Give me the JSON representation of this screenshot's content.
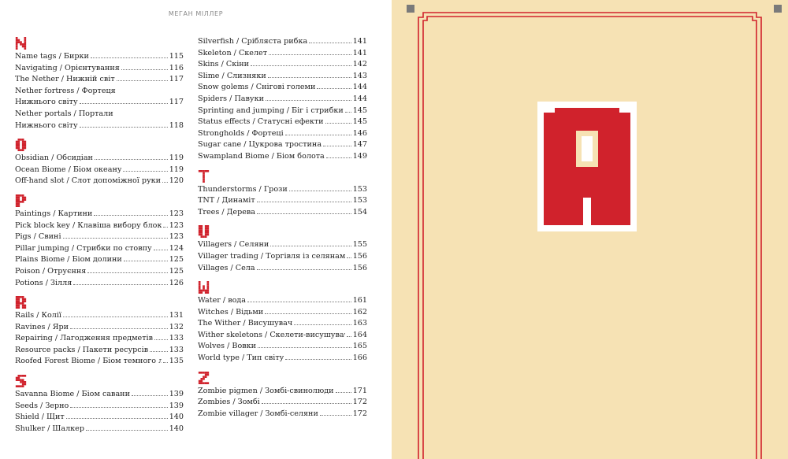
{
  "running_head": "МЕГАН МІЛЛЕР",
  "colors": {
    "accent_red": "#d0222c",
    "page_left": "#ffffff",
    "page_right": "#f6e2b4"
  },
  "left_column": [
    {
      "letter": "N",
      "entries": [
        {
          "text": "Name tags / Бирки",
          "page": "115"
        },
        {
          "text": "Navigating / Орієнтування",
          "page": "116"
        },
        {
          "text": "The Nether / Нижній світ",
          "page": "117"
        },
        {
          "text": "Nether fortress / Фортеця",
          "text2": "Нижнього світу",
          "page": "117"
        },
        {
          "text": "Nether portals / Портали",
          "text2": "Нижнього світу",
          "page": "118"
        }
      ]
    },
    {
      "letter": "O",
      "entries": [
        {
          "text": "Obsidian / Обсидіан",
          "page": "119"
        },
        {
          "text": "Ocean Biome / Біом океану",
          "page": "119"
        },
        {
          "text": "Off-hand slot / Слот допоміжної руки",
          "page": "120"
        }
      ]
    },
    {
      "letter": "P",
      "entries": [
        {
          "text": "Paintings / Картини",
          "page": "123"
        },
        {
          "text": "Pick block key / Клавіша вибору блока",
          "page": "123"
        },
        {
          "text": "Pigs / Свині",
          "page": "123"
        },
        {
          "text": "Pillar jumping / Стрибки по стовпу",
          "page": "124"
        },
        {
          "text": "Plains Biome / Біом долини",
          "page": "125"
        },
        {
          "text": "Poison / Отруєння",
          "page": "125"
        },
        {
          "text": "Potions / Зілля",
          "page": "126"
        }
      ]
    },
    {
      "letter": "R",
      "entries": [
        {
          "text": "Rails / Колії",
          "page": "131"
        },
        {
          "text": "Ravines / Яри",
          "page": "132"
        },
        {
          "text": "Repairing / Лагодження предметів",
          "page": "133"
        },
        {
          "text": "Resource packs / Пакети ресурсів",
          "page": "133"
        },
        {
          "text": "Roofed Forest Biome / Біом темного лісу",
          "page": "135"
        }
      ]
    },
    {
      "letter": "S",
      "entries": [
        {
          "text": "Savanna Biome / Біом савани",
          "page": "139"
        },
        {
          "text": "Seeds / Зерно",
          "page": "139"
        },
        {
          "text": "Shield / Щит",
          "page": "140"
        },
        {
          "text": "Shulker / Шалкер",
          "page": "140"
        }
      ]
    }
  ],
  "right_column": [
    {
      "letter": "",
      "entries": [
        {
          "text": "Silverfish / Срібляста рибка",
          "page": "141"
        },
        {
          "text": "Skeleton / Скелет",
          "page": "141"
        },
        {
          "text": "Skins / Скіни",
          "page": "142"
        },
        {
          "text": "Slime / Слизняки",
          "page": "143"
        },
        {
          "text": "Snow golems / Снігові големи",
          "page": "144"
        },
        {
          "text": "Spiders / Павуки",
          "page": "144"
        },
        {
          "text": "Sprinting and jumping / Біг і стрибки",
          "page": "145"
        },
        {
          "text": "Status effects / Статусні ефекти",
          "page": "145"
        },
        {
          "text": "Strongholds / Фортеці",
          "page": "146"
        },
        {
          "text": "Sugar cane / Цукрова тростина",
          "page": "147"
        },
        {
          "text": "Swampland Biome / Біом болота",
          "page": "149"
        }
      ]
    },
    {
      "letter": "T",
      "entries": [
        {
          "text": "Thunderstorms / Грози",
          "page": "153"
        },
        {
          "text": "TNT / Динаміт",
          "page": "153"
        },
        {
          "text": "Trees / Дерева",
          "page": "154"
        }
      ]
    },
    {
      "letter": "U",
      "entries": [
        {
          "text": "Villagers / Селяни",
          "page": "155"
        },
        {
          "text": "Villager trading / Торгівля із селянами",
          "page": "156"
        },
        {
          "text": "Villages / Села",
          "page": "156"
        }
      ]
    },
    {
      "letter": "W",
      "entries": [
        {
          "text": "Water / вода",
          "page": "161"
        },
        {
          "text": "Witches / Відьми",
          "page": "162"
        },
        {
          "text": "The Wither / Висушувач",
          "page": "163"
        },
        {
          "text": "Wither skeletons / Скелети-висушувачі",
          "page": "164"
        },
        {
          "text": "Wolves / Вовки",
          "page": "165"
        },
        {
          "text": "World type / Тип світу",
          "page": "166"
        }
      ]
    },
    {
      "letter": "Z",
      "entries": [
        {
          "text": "Zombie pigmen / Зомбі-свинолюди",
          "page": "171"
        },
        {
          "text": "Zombies / Зомбі",
          "page": "172"
        },
        {
          "text": "Zombie villager / Зомбі-селяни",
          "page": "172"
        }
      ]
    }
  ],
  "chapter_badge": {
    "letter": "A"
  }
}
